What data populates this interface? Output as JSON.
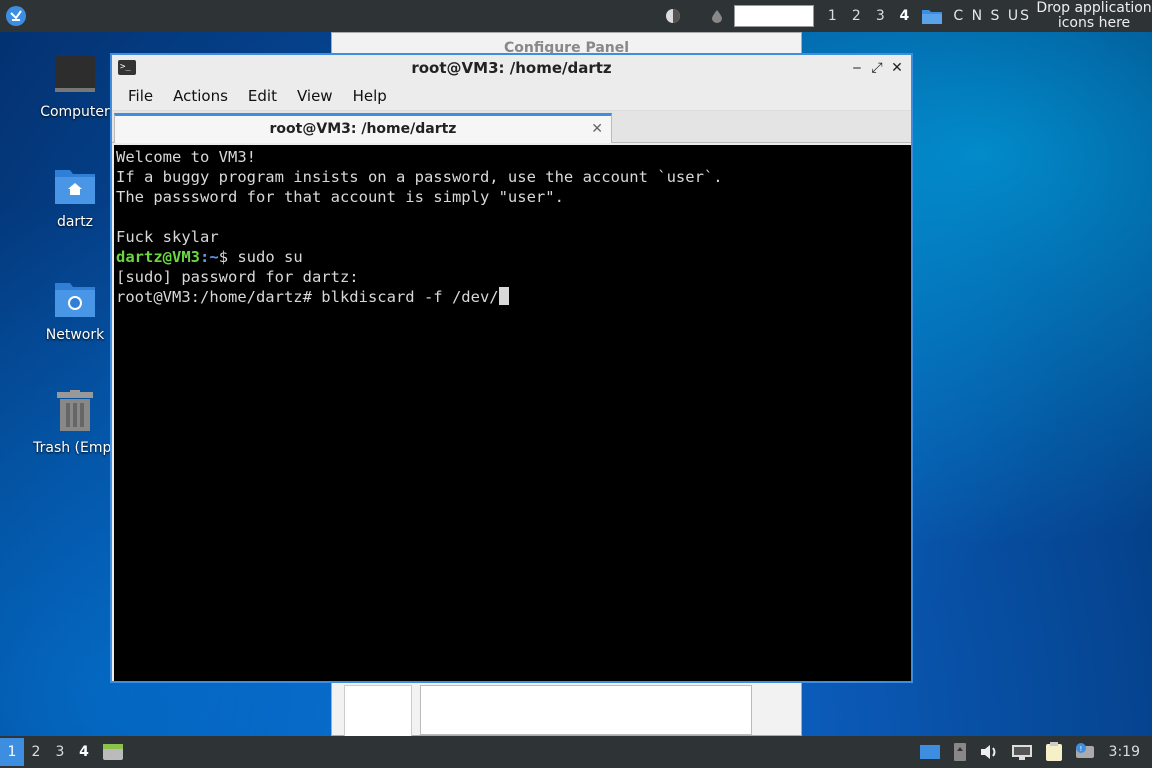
{
  "top_panel": {
    "workspaces": [
      "1",
      "2",
      "3",
      "4"
    ],
    "active_workspace": "4",
    "keyboard_layout": "C N S US",
    "drop_launcher_line1": "Drop application",
    "drop_launcher_line2": "icons here"
  },
  "desktop_icons": [
    {
      "label": "Computer",
      "icon": "monitor-icon"
    },
    {
      "label": "dartz",
      "icon": "home-folder-icon"
    },
    {
      "label": "Network",
      "icon": "network-folder-icon"
    },
    {
      "label": "Trash (Empt",
      "icon": "trash-icon"
    }
  ],
  "background_window": {
    "title": "Configure Panel"
  },
  "terminal": {
    "title": "root@VM3: /home/dartz",
    "menu": [
      "File",
      "Actions",
      "Edit",
      "View",
      "Help"
    ],
    "tab_title": "root@VM3: /home/dartz",
    "lines": {
      "l1": "Welcome to VM3!",
      "l2": "If a buggy program insists on a password, use the account `user`.",
      "l3": "The passsword for that account is simply \"user\".",
      "l5": "Fuck skylar",
      "prompt_user": "dartz@VM3",
      "prompt_colon": ":",
      "prompt_path": "~",
      "prompt_cmd": "$ sudo su",
      "l7": "[sudo] password for dartz:",
      "l8": "root@VM3:/home/dartz# blkdiscard -f /dev/"
    }
  },
  "bottom_panel": {
    "workspaces": [
      "1",
      "2",
      "3",
      "4"
    ],
    "selected_workspace": "1",
    "active_workspace": "4",
    "clock": "3:19"
  },
  "colors": {
    "accent": "#3d8ee0",
    "panel": "#2e3436",
    "prompt_user": "#6ad641",
    "prompt_path": "#5c9cf0"
  }
}
